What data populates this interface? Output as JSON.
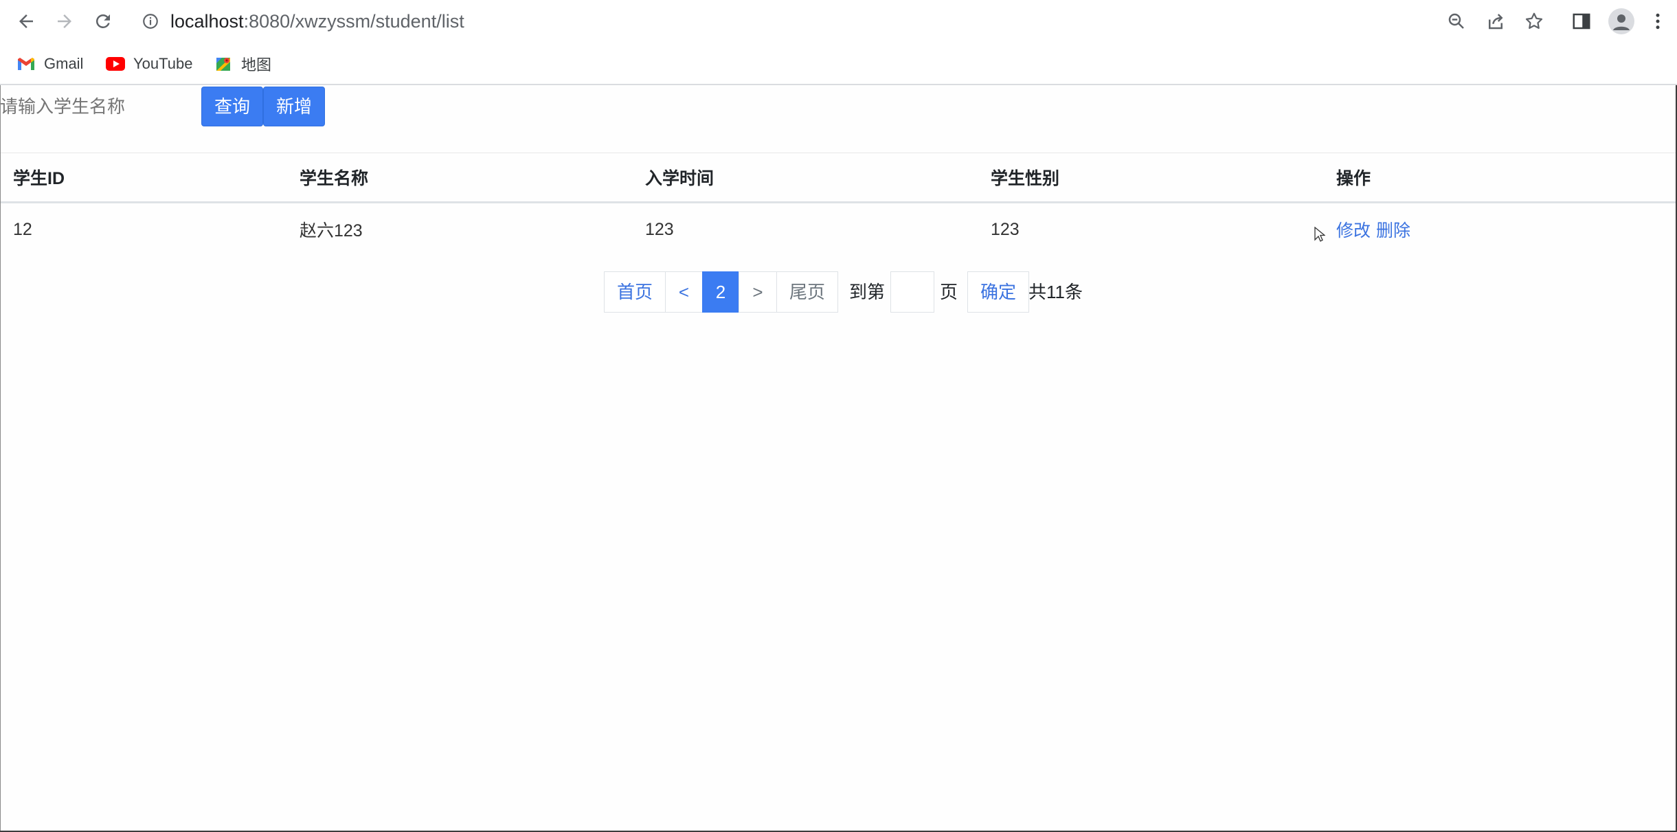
{
  "browser": {
    "url_host": "localhost",
    "url_path": ":8080/xwzyssm/student/list",
    "bookmarks": [
      {
        "label": "Gmail",
        "icon": "gmail-icon"
      },
      {
        "label": "YouTube",
        "icon": "youtube-icon"
      },
      {
        "label": "地图",
        "icon": "maps-icon"
      }
    ]
  },
  "search": {
    "placeholder": "请输入学生名称",
    "query_label": "查询",
    "add_label": "新增"
  },
  "table": {
    "headers": [
      "学生ID",
      "学生名称",
      "入学时间",
      "学生性别",
      "操作"
    ],
    "rows": [
      {
        "id": "12",
        "name": "赵六123",
        "enroll_time": "123",
        "gender": "123",
        "edit": "修改",
        "delete": "删除"
      }
    ]
  },
  "pagination": {
    "first": "首页",
    "prev": "<",
    "current": "2",
    "next": ">",
    "last": "尾页",
    "goto_prefix": "到第",
    "goto_suffix": "页",
    "confirm": "确定",
    "total": "共11条"
  },
  "colors": {
    "primary": "#3b7cf2",
    "link": "#3b73e0"
  }
}
